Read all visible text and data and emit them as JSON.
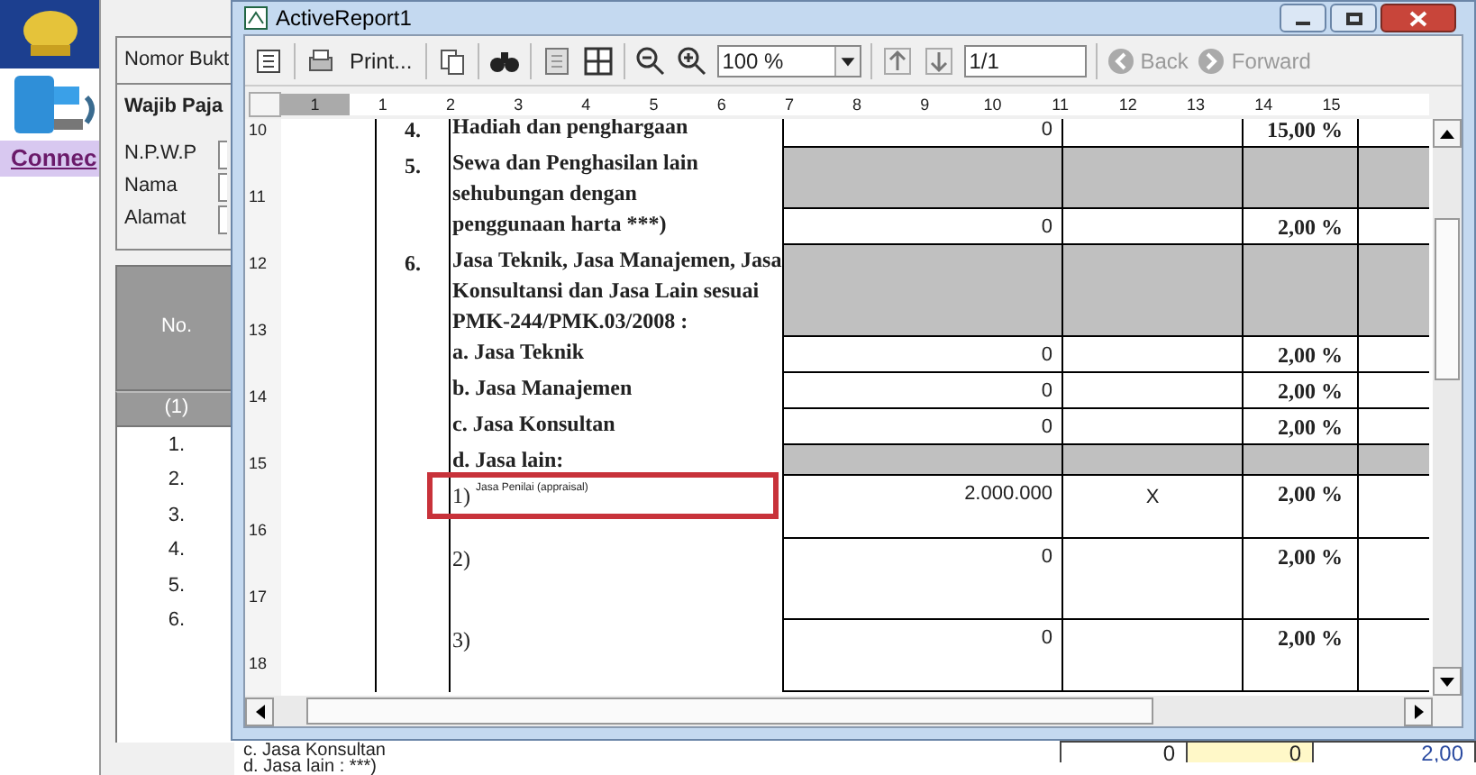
{
  "sidebar": {
    "link": "Connec"
  },
  "form": {
    "number_label": "Nomor Bukt",
    "section_title": "Wajib Paja",
    "fields": [
      {
        "label": "N.P.W.P"
      },
      {
        "label": "Nama"
      },
      {
        "label": "Alamat"
      }
    ]
  },
  "table": {
    "header": "No.",
    "column_index": "(1)",
    "rows": [
      "1.",
      "2.",
      "3.",
      "4.",
      "5.",
      "6."
    ],
    "bottom_lines": [
      "c. Jasa Konsultan",
      "d. Jasa lain : ***)"
    ],
    "bottom_values": [
      {
        "text": "0",
        "highlighted": false
      },
      {
        "text": "0",
        "highlighted": true
      },
      {
        "text": "2,00",
        "highlighted": false
      }
    ]
  },
  "window": {
    "title": "ActiveReport1"
  },
  "toolbar": {
    "print": "Print...",
    "zoom": "100 %",
    "page": "1/1",
    "back": {
      "label": "Back",
      "disabled": true
    },
    "forward": {
      "label": "Forward",
      "disabled": true
    }
  },
  "ruler": {
    "marks": [
      "1",
      "1",
      "2",
      "3",
      "4",
      "5",
      "6",
      "7",
      "8",
      "9",
      "10",
      "11",
      "12",
      "13",
      "14",
      "15"
    ],
    "vertical_marks": [
      "10",
      "11",
      "12",
      "13",
      "14",
      "15",
      "16",
      "17",
      "18"
    ]
  },
  "report": {
    "rows": [
      {
        "kind": "item",
        "no": "4.",
        "text": "Hadiah dan penghargaan",
        "amount": "0",
        "mark": "",
        "rate": "15,00 %",
        "shaded": false,
        "highlighted": false
      },
      {
        "kind": "item",
        "no": "5.",
        "text": "Sewa dan Penghasilan lain sehubungan dengan",
        "amount": "",
        "mark": "",
        "rate": "",
        "shaded": true,
        "highlighted": false
      },
      {
        "kind": "item",
        "no": "",
        "text": "penggunaan harta ***)",
        "amount": "0",
        "mark": "",
        "rate": "2,00 %",
        "shaded": false,
        "highlighted": false
      },
      {
        "kind": "item",
        "no": "6.",
        "text": "Jasa Teknik, Jasa Manajemen, Jasa Konsultansi dan Jasa Lain sesuai PMK-244/PMK.03/2008 :",
        "amount": "",
        "mark": "",
        "rate": "",
        "shaded": true,
        "highlighted": false
      },
      {
        "kind": "item",
        "no": "",
        "text": "a. Jasa Teknik",
        "amount": "0",
        "mark": "",
        "rate": "2,00 %",
        "shaded": false,
        "highlighted": false
      },
      {
        "kind": "item",
        "no": "",
        "text": "b. Jasa Manajemen",
        "amount": "0",
        "mark": "",
        "rate": "2,00 %",
        "shaded": false,
        "highlighted": false
      },
      {
        "kind": "item",
        "no": "",
        "text": "c. Jasa Konsultan",
        "amount": "0",
        "mark": "",
        "rate": "2,00 %",
        "shaded": false,
        "highlighted": false
      },
      {
        "kind": "item",
        "no": "",
        "text": "d. Jasa lain:",
        "amount": "",
        "mark": "",
        "rate": "",
        "shaded": true,
        "highlighted": false
      },
      {
        "kind": "sub",
        "no": "",
        "text": "1)",
        "subtext": "Jasa Penilai (appraisal)",
        "amount": "2.000.000",
        "mark": "X",
        "rate": "2,00 %",
        "shaded": false,
        "highlighted": true
      },
      {
        "kind": "sub",
        "no": "",
        "text": "2)",
        "amount": "0",
        "mark": "",
        "rate": "2,00 %",
        "shaded": false,
        "highlighted": false
      },
      {
        "kind": "sub",
        "no": "",
        "text": "3)",
        "amount": "0",
        "mark": "",
        "rate": "2,00 %",
        "shaded": false,
        "highlighted": false
      }
    ]
  }
}
